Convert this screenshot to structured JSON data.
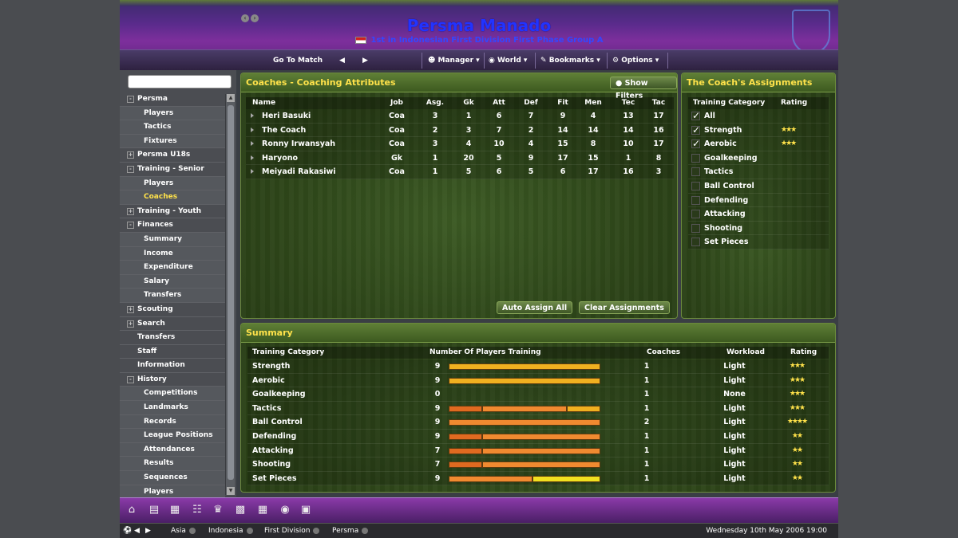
{
  "header": {
    "club_name": "Persma Manado",
    "club_subtitle": "1st in Indonesian First Division First Phase Group A"
  },
  "toolbar": {
    "go_to_match": "Go To Match",
    "manager": "Manager",
    "world": "World",
    "bookmarks": "Bookmarks",
    "options": "Options"
  },
  "nav": {
    "items": [
      {
        "label": "Persma",
        "level": 0,
        "expander": "-"
      },
      {
        "label": "Players",
        "level": 1
      },
      {
        "label": "Tactics",
        "level": 1
      },
      {
        "label": "Fixtures",
        "level": 1
      },
      {
        "label": "Persma U18s",
        "level": 0,
        "expander": "+"
      },
      {
        "label": "Training - Senior",
        "level": 0,
        "expander": "-"
      },
      {
        "label": "Players",
        "level": 1
      },
      {
        "label": "Coaches",
        "level": 1,
        "active": true
      },
      {
        "label": "Training - Youth",
        "level": 0,
        "expander": "+"
      },
      {
        "label": "Finances",
        "level": 0,
        "expander": "-"
      },
      {
        "label": "Summary",
        "level": 1
      },
      {
        "label": "Income",
        "level": 1
      },
      {
        "label": "Expenditure",
        "level": 1
      },
      {
        "label": "Salary",
        "level": 1
      },
      {
        "label": "Transfers",
        "level": 1
      },
      {
        "label": "Scouting",
        "level": 0,
        "expander": "+"
      },
      {
        "label": "Search",
        "level": 0,
        "expander": "+"
      },
      {
        "label": "Transfers",
        "level": 0
      },
      {
        "label": "Staff",
        "level": 0
      },
      {
        "label": "Information",
        "level": 0
      },
      {
        "label": "History",
        "level": 0,
        "expander": "-"
      },
      {
        "label": "Competitions",
        "level": 1
      },
      {
        "label": "Landmarks",
        "level": 1
      },
      {
        "label": "Records",
        "level": 1
      },
      {
        "label": "League Positions",
        "level": 1
      },
      {
        "label": "Attendances",
        "level": 1
      },
      {
        "label": "Results",
        "level": 1
      },
      {
        "label": "Sequences",
        "level": 1
      },
      {
        "label": "Players",
        "level": 1
      }
    ]
  },
  "coaches_panel": {
    "title": "Coaches - Coaching Attributes",
    "show_filters": "Show Filters",
    "columns": [
      "Name",
      "Job",
      "Asg.",
      "Gk",
      "Att",
      "Def",
      "Fit",
      "Men",
      "Tec",
      "Tac"
    ],
    "rows": [
      [
        "Heri Basuki",
        "Coa",
        "3",
        "1",
        "6",
        "7",
        "9",
        "4",
        "13",
        "17"
      ],
      [
        "The Coach",
        "Coa",
        "2",
        "3",
        "7",
        "2",
        "14",
        "14",
        "14",
        "16"
      ],
      [
        "Ronny Irwansyah",
        "Coa",
        "3",
        "4",
        "10",
        "4",
        "15",
        "8",
        "10",
        "17"
      ],
      [
        "Haryono",
        "Gk",
        "1",
        "20",
        "5",
        "9",
        "17",
        "15",
        "1",
        "8"
      ],
      [
        "Meiyadi Rakasiwi",
        "Coa",
        "1",
        "5",
        "6",
        "5",
        "6",
        "17",
        "16",
        "3"
      ]
    ],
    "auto_assign": "Auto Assign All",
    "clear_assign": "Clear Assignments"
  },
  "assign_panel": {
    "title": "The Coach's Assignments",
    "col_category": "Training Category",
    "col_rating": "Rating",
    "items": [
      {
        "label": "All",
        "checked": true,
        "stars": 0,
        "partial": true
      },
      {
        "label": "Strength",
        "checked": true,
        "stars": 3
      },
      {
        "label": "Aerobic",
        "checked": true,
        "stars": 3
      },
      {
        "label": "Goalkeeping",
        "checked": false,
        "stars": 0
      },
      {
        "label": "Tactics",
        "checked": false,
        "stars": 0
      },
      {
        "label": "Ball Control",
        "checked": false,
        "stars": 0
      },
      {
        "label": "Defending",
        "checked": false,
        "stars": 0
      },
      {
        "label": "Attacking",
        "checked": false,
        "stars": 0
      },
      {
        "label": "Shooting",
        "checked": false,
        "stars": 0
      },
      {
        "label": "Set Pieces",
        "checked": false,
        "stars": 0
      }
    ]
  },
  "summary_panel": {
    "title": "Summary",
    "columns": [
      "Training Category",
      "Number Of Players Training",
      "Coaches",
      "Workload",
      "Rating"
    ],
    "rows": [
      {
        "category": "Strength",
        "players": "9",
        "coaches": "1",
        "workload": "Light",
        "stars": 3,
        "bar": [
          [
            0,
            1,
            "#f0b020"
          ]
        ]
      },
      {
        "category": "Aerobic",
        "players": "9",
        "coaches": "1",
        "workload": "Light",
        "stars": 3,
        "bar": [
          [
            0,
            1,
            "#f0b020"
          ]
        ]
      },
      {
        "category": "Goalkeeping",
        "players": "0",
        "coaches": "1",
        "workload": "None",
        "stars": 3,
        "bar": []
      },
      {
        "category": "Tactics",
        "players": "9",
        "coaches": "1",
        "workload": "Light",
        "stars": 3,
        "bar": [
          [
            0,
            0.22,
            "#e06a20"
          ],
          [
            0.22,
            0.78,
            "#f08a30"
          ],
          [
            0.78,
            1,
            "#f0b020"
          ]
        ]
      },
      {
        "category": "Ball Control",
        "players": "9",
        "coaches": "2",
        "workload": "Light",
        "stars": 4,
        "bar": [
          [
            0,
            1,
            "#f08a30"
          ]
        ]
      },
      {
        "category": "Defending",
        "players": "9",
        "coaches": "1",
        "workload": "Light",
        "stars": 2,
        "bar": [
          [
            0,
            0.22,
            "#e06a20"
          ],
          [
            0.22,
            1,
            "#f08a30"
          ]
        ]
      },
      {
        "category": "Attacking",
        "players": "7",
        "coaches": "1",
        "workload": "Light",
        "stars": 2,
        "bar": [
          [
            0,
            0.22,
            "#e06a20"
          ],
          [
            0.22,
            1,
            "#f08a30"
          ]
        ]
      },
      {
        "category": "Shooting",
        "players": "7",
        "coaches": "1",
        "workload": "Light",
        "stars": 2,
        "bar": [
          [
            0,
            0.22,
            "#e06a20"
          ],
          [
            0.22,
            1,
            "#f08a30"
          ]
        ]
      },
      {
        "category": "Set Pieces",
        "players": "9",
        "coaches": "1",
        "workload": "Light",
        "stars": 2,
        "bar": [
          [
            0,
            0.55,
            "#f08a30"
          ],
          [
            0.55,
            1,
            "#f0e020"
          ]
        ]
      }
    ]
  },
  "status": {
    "crumbs": [
      "Asia",
      "Indonesia",
      "First Division",
      "Persma"
    ],
    "datetime": "Wednesday 10th May 2006 19:00"
  }
}
